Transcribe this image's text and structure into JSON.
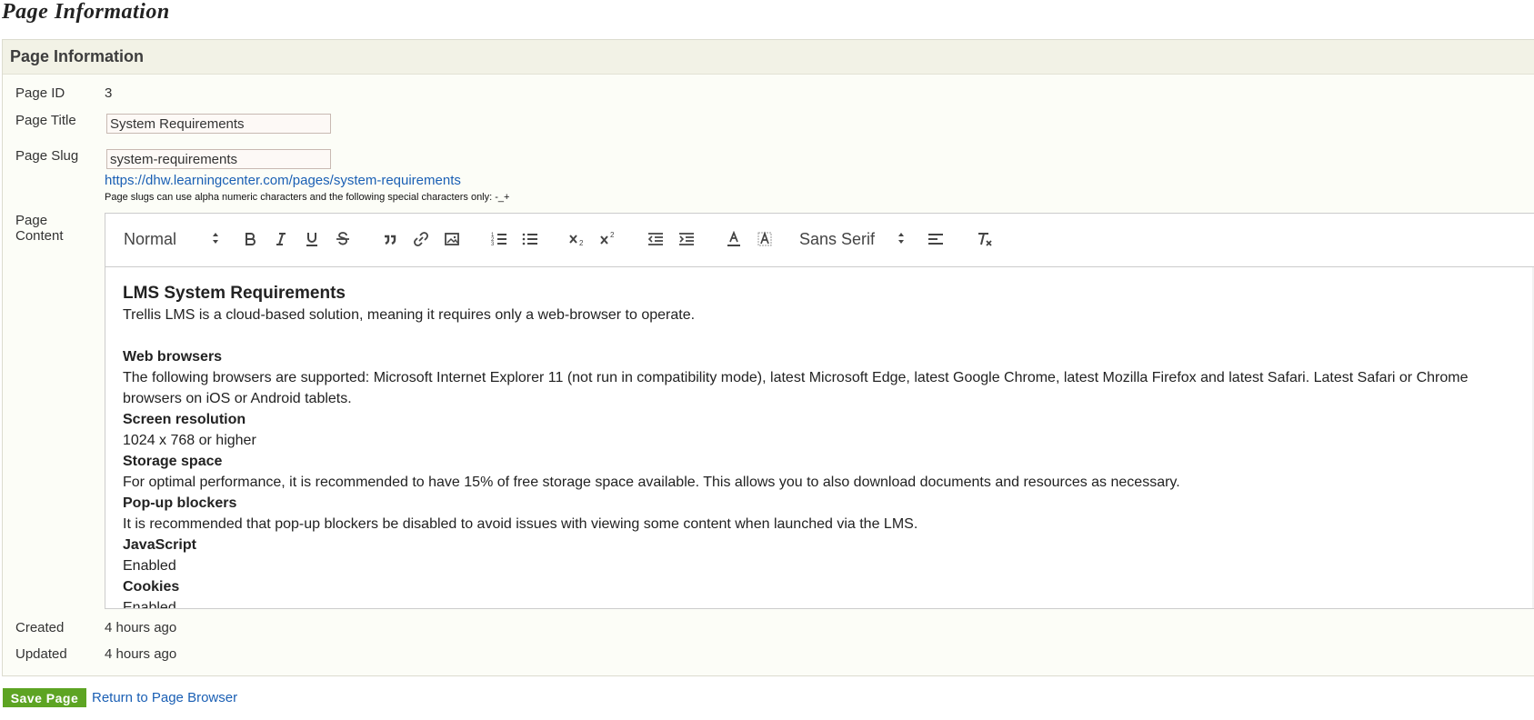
{
  "page_heading": "Page Information",
  "panel": {
    "title": "Page Information"
  },
  "fields": {
    "page_id_label": "Page ID",
    "page_id_value": "3",
    "page_title_label": "Page Title",
    "page_title_value": "System Requirements",
    "page_slug_label": "Page Slug",
    "page_slug_value": "system-requirements",
    "slug_url": "https://dhw.learningcenter.com/pages/system-requirements",
    "slug_help": "Page slugs can use alpha numeric characters and the following special characters only: -_+",
    "page_content_label_1": "Page",
    "page_content_label_2": "Content",
    "created_label": "Created",
    "created_value": "4 hours ago",
    "updated_label": "Updated",
    "updated_value": "4 hours ago"
  },
  "editor": {
    "toolbar": {
      "header_picker": "Normal",
      "font_picker": "Sans Serif",
      "icons": [
        "bold-icon",
        "italic-icon",
        "underline-icon",
        "strikethrough-icon",
        "blockquote-icon",
        "link-icon",
        "image-icon",
        "ordered-list-icon",
        "bullet-list-icon",
        "subscript-icon",
        "superscript-icon",
        "outdent-icon",
        "indent-icon",
        "text-color-icon",
        "background-color-icon",
        "align-icon",
        "clear-formatting-icon"
      ]
    },
    "content": {
      "heading": "LMS System Requirements",
      "intro": "Trellis LMS is a cloud-based solution, meaning it requires only a web-browser to operate.",
      "sections": [
        {
          "title": "Web browsers",
          "body": "The following browsers are supported: Microsoft Internet Explorer 11 (not run in compatibility mode), latest Microsoft Edge, latest Google Chrome, latest Mozilla Firefox and latest Safari. Latest Safari or Chrome browsers on iOS or Android tablets."
        },
        {
          "title": "Screen resolution",
          "body": "1024 x 768 or higher"
        },
        {
          "title": "Storage space",
          "body": "For optimal performance, it is recommended to have 15% of free storage space available. This allows you to also download documents and resources as necessary."
        },
        {
          "title": "Pop-up blockers",
          "body": "It is recommended that pop-up blockers be disabled to avoid issues with viewing some content when launched via the LMS."
        },
        {
          "title": "JavaScript",
          "body": "Enabled"
        },
        {
          "title": "Cookies",
          "body": "Enabled"
        }
      ]
    }
  },
  "actions": {
    "save_label": "Save Page",
    "return_label": "Return to Page Browser"
  }
}
